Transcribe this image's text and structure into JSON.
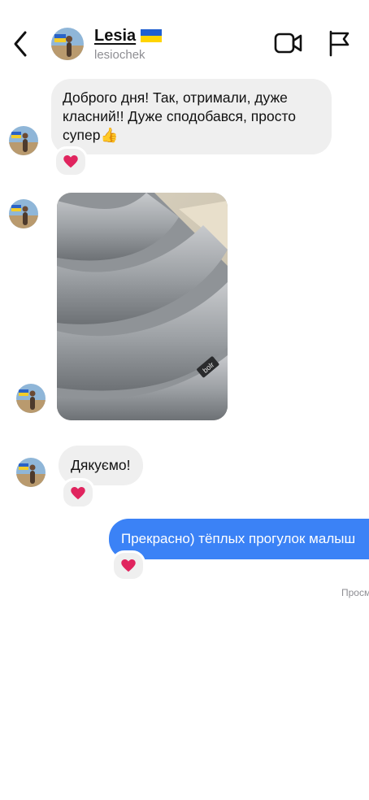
{
  "header": {
    "contact_name": "Lesia",
    "username": "lesiochek",
    "back_icon": "chevron-left-icon",
    "video_icon": "video-camera-icon",
    "report_icon": "flag-icon"
  },
  "messages": [
    {
      "sender": "them",
      "text": "Доброго дня! Так, отримали, дуже класний!! Дуже сподобався, просто супер👍",
      "reaction": "red-heart"
    },
    {
      "sender": "them",
      "type": "photo",
      "photo_caption_text": "bolr"
    },
    {
      "sender": "them",
      "text": "Дякуємо!",
      "reaction": "red-heart"
    },
    {
      "sender": "me",
      "text": "Прекрасно) тёплых прогулок малыш",
      "reaction": "red-heart"
    }
  ],
  "status": {
    "seen_text": "Просм"
  },
  "colors": {
    "outgoing_bubble": "#3b82f6",
    "incoming_bubble": "#efefef",
    "heart": "#e0245e",
    "muted_text": "#8e8e93"
  }
}
